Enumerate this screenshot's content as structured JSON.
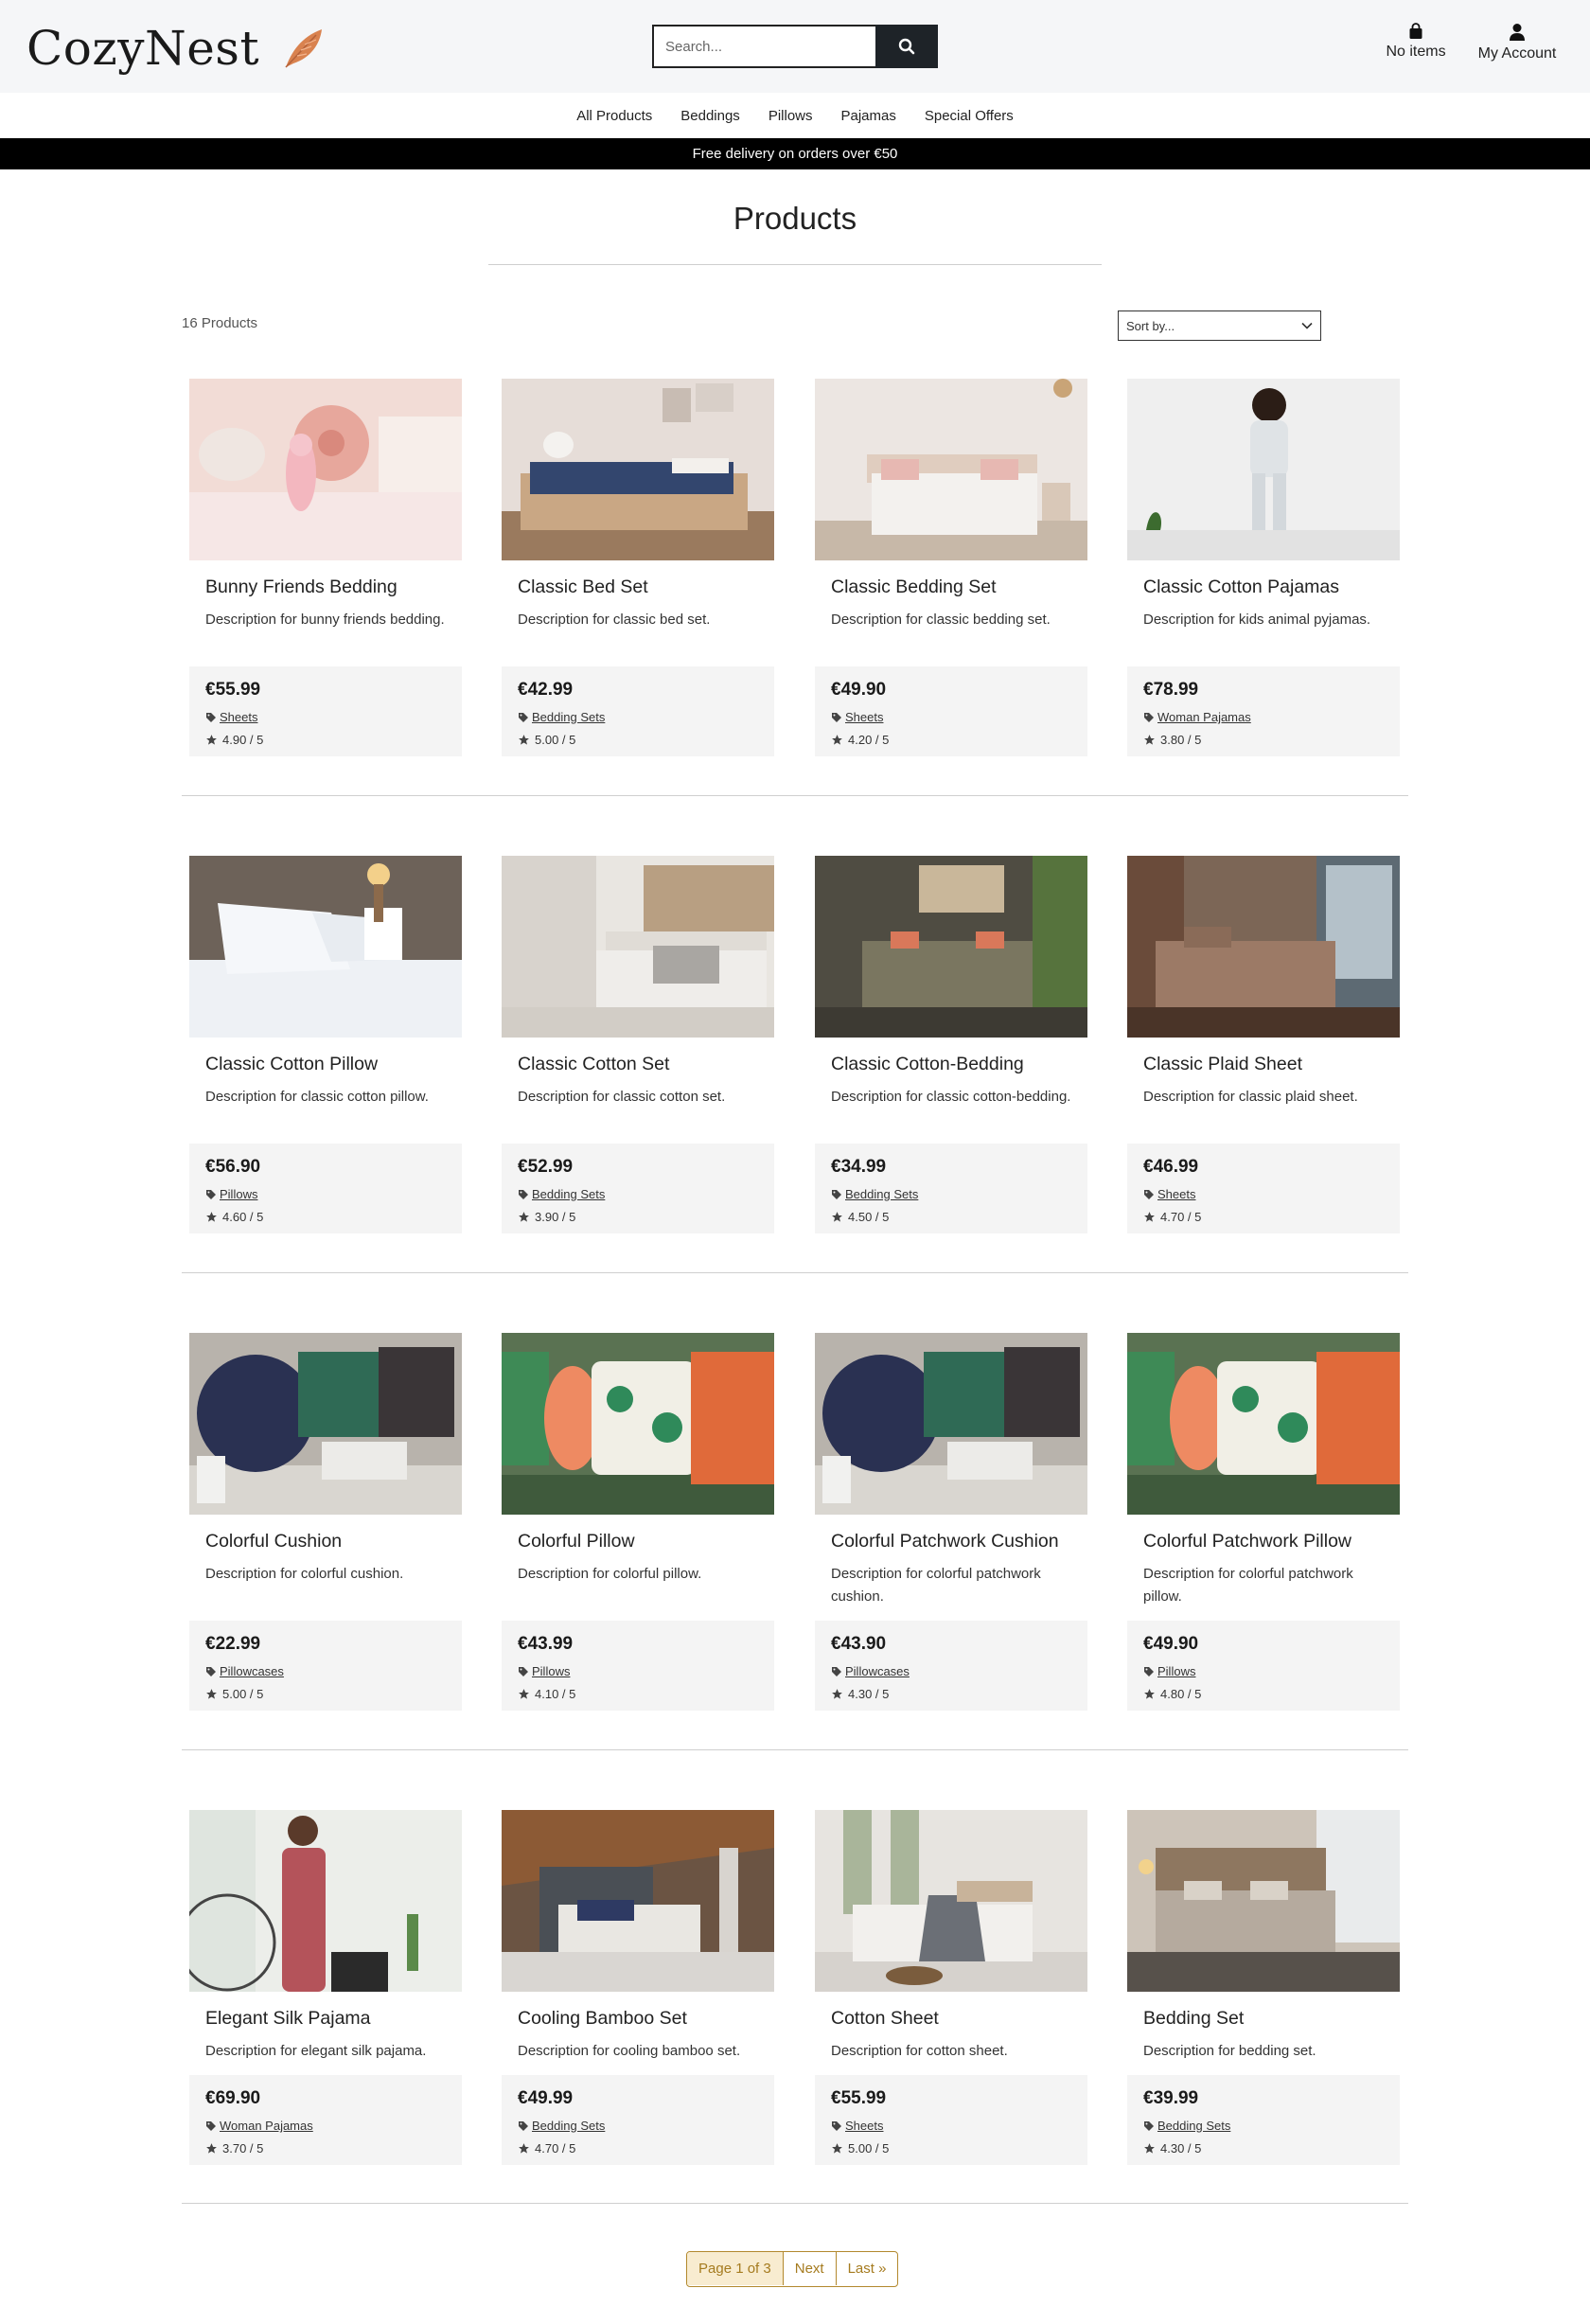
{
  "brand": {
    "name": "CozyNest",
    "logo_icon": "feather-icon",
    "accent": "#d9824f"
  },
  "search": {
    "placeholder": "Search..."
  },
  "header": {
    "bag_label": "No items",
    "account_label": "My Account"
  },
  "nav": [
    "All Products",
    "Beddings",
    "Pillows",
    "Pajamas",
    "Special Offers"
  ],
  "promo": "Free delivery on orders over €50",
  "page": {
    "title": "Products",
    "count": "16 Products",
    "sort_label": "Sort by..."
  },
  "products": [
    {
      "title": "Bunny Friends Bedding",
      "desc": "Description for bunny friends bedding.",
      "price": "€55.99",
      "category": "Sheets",
      "rating": "4.90 / 5"
    },
    {
      "title": "Classic Bed Set",
      "desc": "Description for classic bed set.",
      "price": "€42.99",
      "category": "Bedding Sets",
      "rating": "5.00 / 5"
    },
    {
      "title": "Classic Bedding Set",
      "desc": "Description for classic bedding set.",
      "price": "€49.90",
      "category": "Sheets",
      "rating": "4.20 / 5"
    },
    {
      "title": "Classic Cotton Pajamas",
      "desc": "Description for kids animal pyjamas.",
      "price": "€78.99",
      "category": "Woman Pajamas",
      "rating": "3.80 / 5"
    },
    {
      "title": "Classic Cotton Pillow",
      "desc": "Description for classic cotton pillow.",
      "price": "€56.90",
      "category": "Pillows",
      "rating": "4.60 / 5"
    },
    {
      "title": "Classic Cotton Set",
      "desc": "Description for classic cotton set.",
      "price": "€52.99",
      "category": "Bedding Sets",
      "rating": "3.90 / 5"
    },
    {
      "title": "Classic Cotton-Bedding",
      "desc": "Description for classic cotton-bedding.",
      "price": "€34.99",
      "category": "Bedding Sets",
      "rating": "4.50 / 5"
    },
    {
      "title": "Classic Plaid Sheet",
      "desc": "Description for classic plaid sheet.",
      "price": "€46.99",
      "category": "Sheets",
      "rating": "4.70 / 5"
    },
    {
      "title": "Colorful Cushion",
      "desc": "Description for colorful cushion.",
      "price": "€22.99",
      "category": "Pillowcases",
      "rating": "5.00 / 5"
    },
    {
      "title": "Colorful Pillow",
      "desc": "Description for colorful pillow.",
      "price": "€43.99",
      "category": "Pillows",
      "rating": "4.10 / 5"
    },
    {
      "title": "Colorful Patchwork Cushion",
      "desc": "Description for colorful patchwork cushion.",
      "price": "€43.90",
      "category": "Pillowcases",
      "rating": "4.30 / 5"
    },
    {
      "title": "Colorful Patchwork Pillow",
      "desc": "Description for colorful patchwork pillow.",
      "price": "€49.90",
      "category": "Pillows",
      "rating": "4.80 / 5"
    },
    {
      "title": "Elegant Silk Pajama",
      "desc": "Description for elegant silk pajama.",
      "price": "€69.90",
      "category": "Woman Pajamas",
      "rating": "3.70 / 5"
    },
    {
      "title": "Cooling Bamboo Set",
      "desc": "Description for cooling bamboo set.",
      "price": "€49.99",
      "category": "Bedding Sets",
      "rating": "4.70 / 5"
    },
    {
      "title": "Cotton Sheet",
      "desc": "Description for cotton sheet.",
      "price": "€55.99",
      "category": "Sheets",
      "rating": "5.00 / 5"
    },
    {
      "title": "Bedding Set",
      "desc": "Description for bedding set.",
      "price": "€39.99",
      "category": "Bedding Sets",
      "rating": "4.30 / 5"
    }
  ],
  "pagination": {
    "current": "Page 1 of 3",
    "next": "Next",
    "last": "Last »"
  }
}
